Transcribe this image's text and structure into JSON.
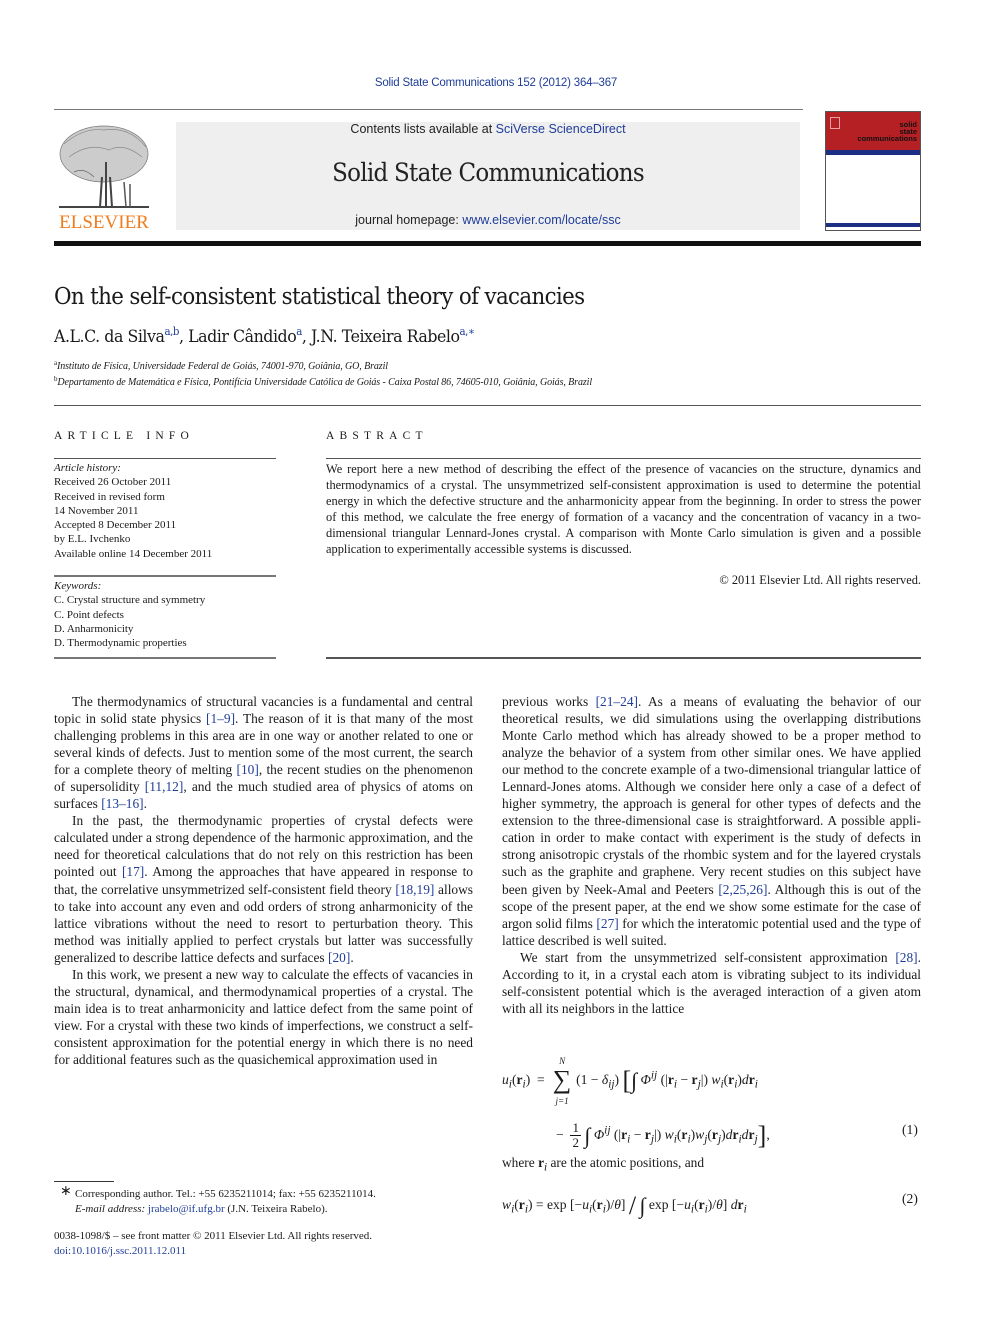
{
  "header": {
    "citation": "Solid State Communications 152 (2012) 364–367",
    "contents_prefix": "Contents lists available at ",
    "contents_link": "SciVerse ScienceDirect",
    "journal_title": "Solid State Communications",
    "homepage_prefix": "journal homepage: ",
    "homepage_link": "www.elsevier.com/locate/ssc",
    "publisher_logo_text": "ELSEVIER",
    "cover_title_lines": [
      "solid",
      "state",
      "communications"
    ]
  },
  "article": {
    "title": "On the self-consistent statistical theory of vacancies",
    "authors": [
      {
        "name": "A.L.C. da Silva",
        "sup": "a,b",
        "sep": ", "
      },
      {
        "name": "Ladir Cândido",
        "sup": "a",
        "sep": ", "
      },
      {
        "name": "J.N. Teixeira Rabelo",
        "sup": "a,∗",
        "sep": ""
      }
    ],
    "affiliations": [
      {
        "mark": "a",
        "text": "Instituto de Física, Universidade Federal de Goiás, 74001-970, Goiânia, GO, Brazil"
      },
      {
        "mark": "b",
        "text": "Departamento de Matemática e Física, Pontifícia Universidade Católica de Goiás - Caixa Postal 86, 74605-010, Goiânia, Goiás, Brazil"
      }
    ]
  },
  "article_info": {
    "heading": "ARTICLE INFO",
    "history_label": "Article history:",
    "history": [
      "Received 26 October 2011",
      "Received in revised form",
      "14 November 2011",
      "Accepted 8 December 2011",
      "by E.L. Ivchenko",
      "Available online 14 December 2011"
    ],
    "keywords_label": "Keywords:",
    "keywords": [
      "C. Crystal structure and symmetry",
      "C. Point defects",
      "D. Anharmonicity",
      "D. Thermodynamic properties"
    ]
  },
  "abstract": {
    "heading": "ABSTRACT",
    "text": "We report here a new method of describing the effect of the presence of vacancies on the structure, dynamics and thermodynamics of a crystal. The unsymmetrized self-consistent approximation is used to determine the potential energy in which the defective structure and the anharmonicity appear from the beginning. In order to stress the power of this method, we calculate the free energy of formation of a vacancy and the concentration of vacancy in a two-dimensional triangular Lennard-Jones crystal. A comparison with Monte Carlo simulation is given and a possible application to experimentally accessible systems is discussed.",
    "copyright": "© 2011 Elsevier Ltd. All rights reserved."
  },
  "body": {
    "left_paragraphs": [
      [
        {
          "t": "The thermodynamics of structural vacancies is a fundamental and central topic in solid state physics "
        },
        {
          "ref": "[1–9]"
        },
        {
          "t": ". The reason of it is that many of the most challenging problems in this area are in one way or another related to one or several kinds of defects. Just to mention some of the most current, the search for a complete theory of melting "
        },
        {
          "ref": "[10]"
        },
        {
          "t": ", the recent studies on the phenomenon of supersolidity "
        },
        {
          "ref": "[11,12]"
        },
        {
          "t": ", and the much studied area of physics of atoms on surfaces "
        },
        {
          "ref": "[13–16]"
        },
        {
          "t": "."
        }
      ],
      [
        {
          "t": "In the past, the thermodynamic properties of crystal defects were calculated under a strong dependence of the harmonic approximation, and the need for theoretical calculations that do not rely on this restriction has been pointed out "
        },
        {
          "ref": "[17]"
        },
        {
          "t": ". Among the approaches that have appeared in response to that, the correlative unsymmetrized self-consistent field theory "
        },
        {
          "ref": "[18,19]"
        },
        {
          "t": " allows to take into account any even and odd orders of strong anharmonicity of the lattice vibrations without the need to resort to perturbation theory. This method was initially applied to perfect crystals but latter was successfully generalized to describe lattice defects and surfaces "
        },
        {
          "ref": "[20]"
        },
        {
          "t": "."
        }
      ],
      [
        {
          "t": "In this work, we present a new way to calculate the effects of va­cancies in the structural, dynamical, and thermodynamical proper­ties of a crystal. The main idea is to treat anharmonicity and lattice defect from the same point of view. For a crystal with these two kinds of imperfections, we construct a self-consistent approxima­tion for the potential energy in which there is no need for addi­tional features such as the quasichemical approximation used in"
        }
      ]
    ],
    "right_paragraphs": [
      [
        {
          "t": "previous works "
        },
        {
          "ref": "[21–24]"
        },
        {
          "t": ". As a means of evaluating the behavior of our theoretical results, we did simulations using the overlapping distributions Monte Carlo method which has already showed to be a proper method to analyze the behavior of a system from other similar ones. We have applied our method to the concrete example of a two-dimensional triangular lattice of Lennard-Jones atoms. Al­though we consider here only a case of a defect of higher symmetry, the approach is general for other types of defects and the extension to the three-dimensional case is straightforward. A possible appli­cation in order to make contact with experiment is the study of defects in strong anisotropic crystals of the rhombic system and for the layered crystals such as the graphite and graphene. Very recent studies on this subject have been given by Neek-Amal and Peeters "
        },
        {
          "ref": "[2,25,26]"
        },
        {
          "t": ". Although this is out of the scope of the present paper, at the end we show some estimate for the case of argon solid films "
        },
        {
          "ref": "[27]"
        },
        {
          "t": " for which the interatomic potential used and the type of lattice described is well suited."
        }
      ],
      [
        {
          "t": "We start from the unsymmetrized self-consistent approxima­tion "
        },
        {
          "ref": "[28]"
        },
        {
          "t": ". According to it, in a crystal each atom is vibrating subject to its individual self-consistent potential which is the averaged in­teraction of a given atom with all its neighbors in the lattice"
        }
      ]
    ],
    "equations": {
      "eq1_number": "(1)",
      "eq2_number": "(2)",
      "where_text_before": "where ",
      "where_symbol": "r",
      "where_sub": "i",
      "where_text_after": " are the atomic positions, and"
    }
  },
  "footnote": {
    "star": "∗",
    "corresponding": "Corresponding author. Tel.: +55 6235211014; fax: +55 6235211014.",
    "email_label": "E-mail address:",
    "email": "jrabelo@if.ufg.br",
    "email_owner": " (J.N. Teixeira Rabelo)."
  },
  "front_matter": {
    "issn_line": "0038-1098/$ – see front matter © 2011 Elsevier Ltd. All rights reserved.",
    "doi": "doi:10.1016/j.ssc.2011.12.011"
  },
  "colors": {
    "link": "#1f3d99",
    "elsevier_orange": "#f07c1c",
    "cover_red": "#b52025",
    "cover_blue": "#1d2f84",
    "banner_gray": "#efefef"
  }
}
